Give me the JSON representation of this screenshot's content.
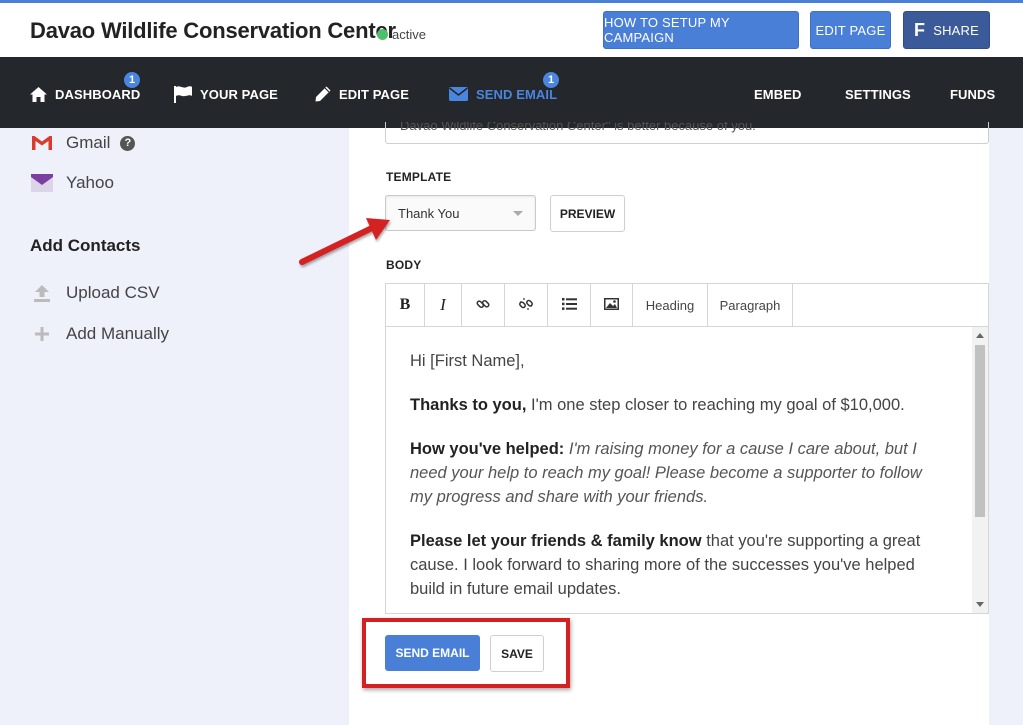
{
  "header": {
    "title": "Davao Wildlife Conservation Center",
    "status": "active",
    "buttons": {
      "setup": "HOW TO SETUP MY CAMPAIGN",
      "edit": "EDIT PAGE",
      "share": "SHARE"
    }
  },
  "nav": {
    "left": [
      {
        "label": "DASHBOARD",
        "icon": "home-icon",
        "badge": "1"
      },
      {
        "label": "YOUR PAGE",
        "icon": "flag-icon"
      },
      {
        "label": "EDIT PAGE",
        "icon": "pencil-icon"
      },
      {
        "label": "SEND EMAIL",
        "icon": "envelope-icon",
        "badge": "1",
        "active": true
      }
    ],
    "right": [
      "EMBED",
      "SETTINGS",
      "FUNDS"
    ]
  },
  "sidebar": {
    "providers": [
      {
        "label": "Gmail",
        "icon": "gmail-icon",
        "help": "?"
      },
      {
        "label": "Yahoo",
        "icon": "yahoo-icon"
      }
    ],
    "contacts_heading": "Add Contacts",
    "contacts": [
      {
        "label": "Upload CSV",
        "icon": "upload-icon"
      },
      {
        "label": "Add Manually",
        "icon": "plus-icon"
      }
    ]
  },
  "main": {
    "subject_tail": "Davao Wildlife Conservation Center\" is better because of you.",
    "template_label": "TEMPLATE",
    "template_value": "Thank You",
    "preview": "PREVIEW",
    "body_label": "BODY",
    "toolbar": {
      "bold": "B",
      "italic": "I",
      "heading": "Heading",
      "paragraph": "Paragraph"
    },
    "body": {
      "greeting": "Hi [First Name],",
      "p1_bold": "Thanks to you,",
      "p1_text": " I'm one step closer to reaching my goal of $10,000.",
      "p2_bold": "How you've helped:",
      "p2_italic": " I'm raising money for a cause I care about, but I need your help to reach my goal! Please become a supporter to follow my progress and share with your friends.",
      "p3_bold": "Please let your friends & family know",
      "p3_text": " that you're supporting a great cause. I look forward to sharing more of the successes you've helped build in future email updates."
    },
    "send": "SEND EMAIL",
    "save": "SAVE"
  },
  "colors": {
    "accent": "#4a7fd8",
    "facebook": "#3b5a9a",
    "nav_bg": "#24272b",
    "active_dot": "#4cc06a",
    "annotation": "#d42020"
  }
}
